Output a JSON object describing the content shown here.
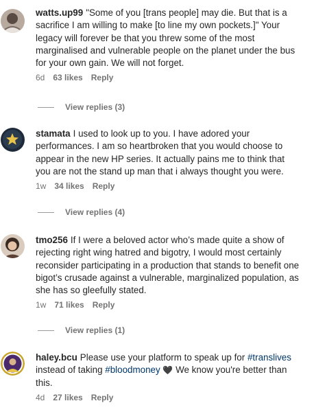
{
  "comments": [
    {
      "username": "watts.up99",
      "text_before": "\"Some of you [trans people] may die. But that is a sacrifice I am willing to make [to line my own pockets.]\" Your legacy will forever be that you threw some of the most marginalised and vulnerable people on the planet under the bus for your own gain. We will not forget.",
      "time": "6d",
      "likes": "63 likes",
      "reply": "Reply",
      "view_replies": "View replies (3)"
    },
    {
      "username": "stamata",
      "text_before": "I used to look up to you. I have adored your performances. I am so heartbroken that you would choose to appear in the new HP series. It actually pains me to think that you are not the stand up man that i always thought you were.",
      "time": "1w",
      "likes": "34 likes",
      "reply": "Reply",
      "view_replies": "View replies (4)"
    },
    {
      "username": "tmo256",
      "text_before": "If I were a beloved actor who’s made quite a show of rejecting right wing hatred and bigotry, I would most certainly reconsider participating in a production that stands to benefit one bigot’s crusade against a vulnerable, marginalized population, as she has so gleefully stated.",
      "time": "1w",
      "likes": "71 likes",
      "reply": "Reply",
      "view_replies": "View replies (1)"
    },
    {
      "username": "haley.bcu",
      "text_before": "Please use your platform to speak up for",
      "hashtag1": "#translives",
      "text_mid": "instead of taking",
      "hashtag2": "#bloodmoney",
      "heart": "🖤",
      "text_after": "We know you're better than this.",
      "time": "4d",
      "likes": "27 likes",
      "reply": "Reply"
    }
  ],
  "colors": {
    "text": "#262626",
    "meta": "#737373",
    "hashtag": "#00376b"
  }
}
